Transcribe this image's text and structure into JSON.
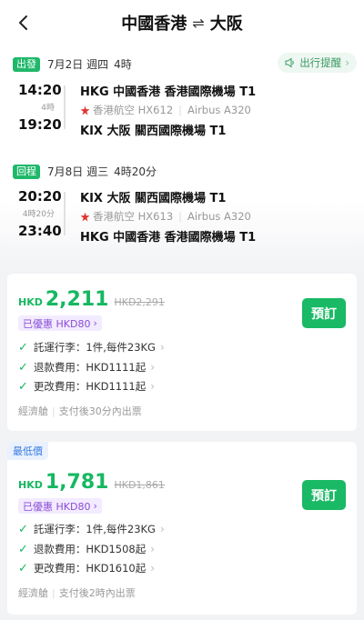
{
  "header": {
    "origin": "中國香港",
    "swap_icon": "⇌",
    "destination": "大阪"
  },
  "reminder": {
    "label": "出行提醒"
  },
  "outbound": {
    "tag": "出發",
    "date": "7月2日 週四",
    "duration": "4時",
    "dep_time": "14:20",
    "arr_time": "19:20",
    "leg_duration": "4時",
    "dep_airport": "HKG 中國香港 香港國際機場 T1",
    "airline": "香港航空 HX612",
    "aircraft": "Airbus A320",
    "arr_airport": "KIX 大阪 關西國際機場 T1"
  },
  "return": {
    "tag": "回程",
    "date": "7月8日 週三",
    "duration": "4時20分",
    "dep_time": "20:20",
    "arr_time": "23:40",
    "leg_duration": "4時20分",
    "dep_airport": "KIX 大阪 關西國際機場 T1",
    "airline": "香港航空 HX613",
    "aircraft": "Airbus A320",
    "arr_airport": "HKG 中國香港 香港國際機場 T1"
  },
  "offers": [
    {
      "currency": "HKD",
      "price": "2,211",
      "original": "HKD2,291",
      "promo": "已優惠 HKD80",
      "button": "預訂",
      "features": [
        "託運行李：1件,每件23KG",
        "退款費用：HKD1111起",
        "更改費用：HKD1111起"
      ],
      "cabin": "經濟艙",
      "ticketing": "支付後30分內出票"
    },
    {
      "badge": "最低價",
      "currency": "HKD",
      "price": "1,781",
      "original": "HKD1,861",
      "promo": "已優惠 HKD80",
      "button": "預訂",
      "features": [
        "託運行李：1件,每件23KG",
        "退款費用：HKD1508起",
        "更改費用：HKD1610起"
      ],
      "cabin": "經濟艙",
      "ticketing": "支付後2時內出票"
    }
  ],
  "colors": {
    "accent": "#19b965",
    "promo": "#8a4dd6",
    "badge": "#3b7be0"
  }
}
